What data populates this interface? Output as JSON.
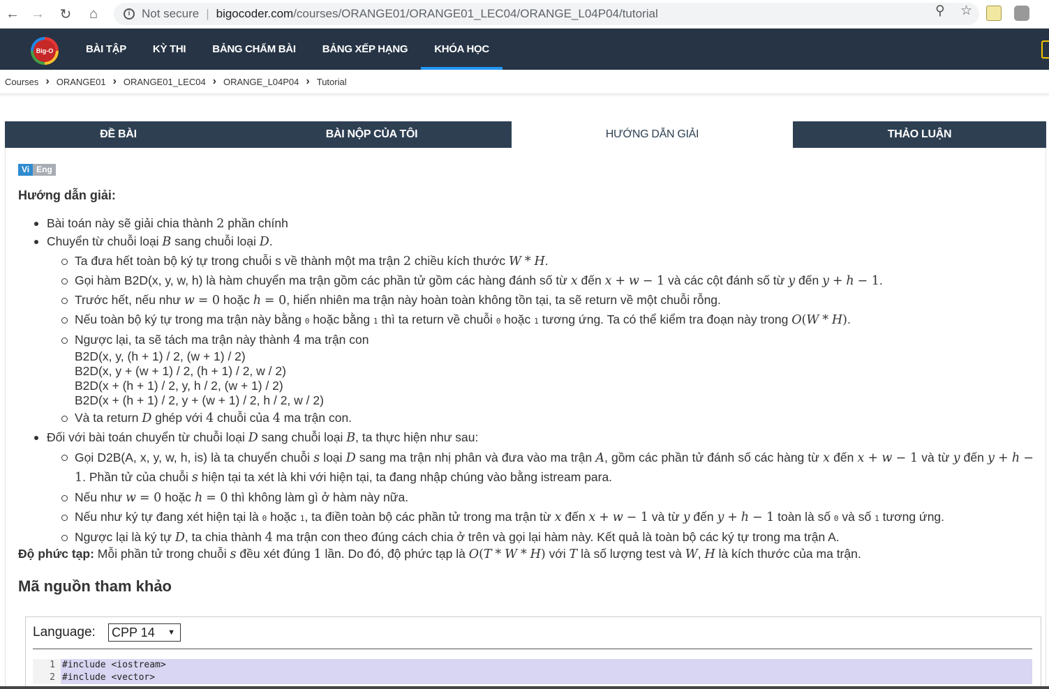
{
  "browser": {
    "not_secure": "Not secure",
    "host": "bigocoder.com",
    "path": "/courses/ORANGE01/ORANGE01_LEC04/ORANGE_L04P04/tutorial"
  },
  "header": {
    "logo_text": "Big-O",
    "nav": [
      "BÀI TẬP",
      "KỲ THI",
      "BẢNG CHẤM BÀI",
      "BẢNG XẾP HẠNG",
      "KHÓA HỌC"
    ]
  },
  "breadcrumb": [
    "Courses",
    "ORANGE01",
    "ORANGE01_LEC04",
    "ORANGE_L04P04",
    "Tutorial"
  ],
  "tabs": [
    "ĐỀ BÀI",
    "BÀI NỘP CỦA TÔI",
    "HƯỚNG DẪN GIẢI",
    "THẢO LUẬN"
  ],
  "lang_toggle": {
    "vi": "Vi",
    "en": "Eng"
  },
  "section_title": "Hướng dẫn giải:",
  "complexity": {
    "label": "Độ phức tạp:"
  },
  "source_title": "Mã nguồn tham khảo",
  "code": {
    "language_label": "Language:",
    "language_value": "CPP 14",
    "lines": [
      {
        "n": "1",
        "text": "#include <iostream>"
      },
      {
        "n": "2",
        "text": "#include <vector>"
      }
    ]
  }
}
